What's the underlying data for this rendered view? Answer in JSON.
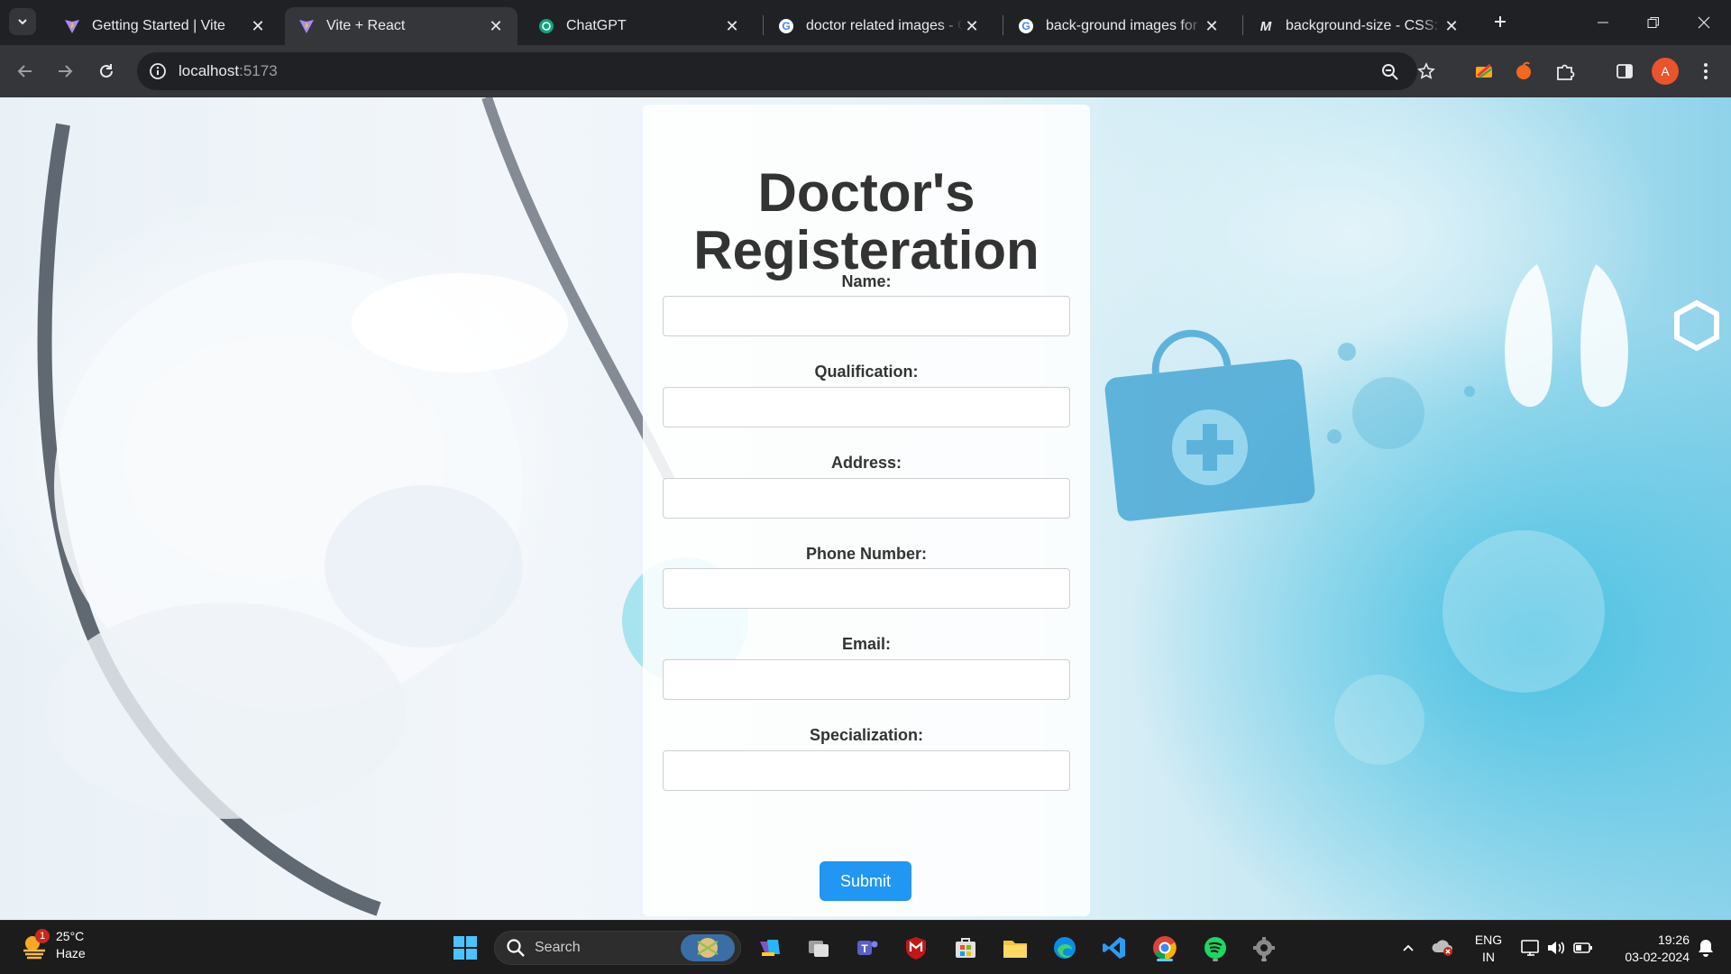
{
  "browser": {
    "tabs": [
      {
        "title": "Getting Started | Vite",
        "active": false
      },
      {
        "title": "Vite + React",
        "active": true
      },
      {
        "title": "ChatGPT",
        "active": false
      },
      {
        "title": "doctor related images - Google Search",
        "active": false
      },
      {
        "title": "back-ground images for doctor",
        "active": false
      },
      {
        "title": "background-size - CSS: Cascading Style Sheets",
        "active": false
      }
    ],
    "url_host": "localhost",
    "url_port": ":5173",
    "profile_initial": "A"
  },
  "form": {
    "title_line1": "Doctor's",
    "title_line2": "Registeration",
    "fields": [
      {
        "label": "Name:",
        "value": ""
      },
      {
        "label": "Qualification:",
        "value": ""
      },
      {
        "label": "Address:",
        "value": ""
      },
      {
        "label": "Phone Number:",
        "value": ""
      },
      {
        "label": "Email:",
        "value": ""
      },
      {
        "label": "Specialization:",
        "value": ""
      }
    ],
    "submit_label": "Submit"
  },
  "taskbar": {
    "weather_temp": "25°C",
    "weather_desc": "Haze",
    "weather_badge": "1",
    "search_label": "Search",
    "lang_line1": "ENG",
    "lang_line2": "IN",
    "time": "19:26",
    "date": "03-02-2024"
  },
  "colors": {
    "accent": "#2196f3",
    "title_text": "#333333",
    "browser_bg": "#202124",
    "toolbar_bg": "#35363a"
  }
}
